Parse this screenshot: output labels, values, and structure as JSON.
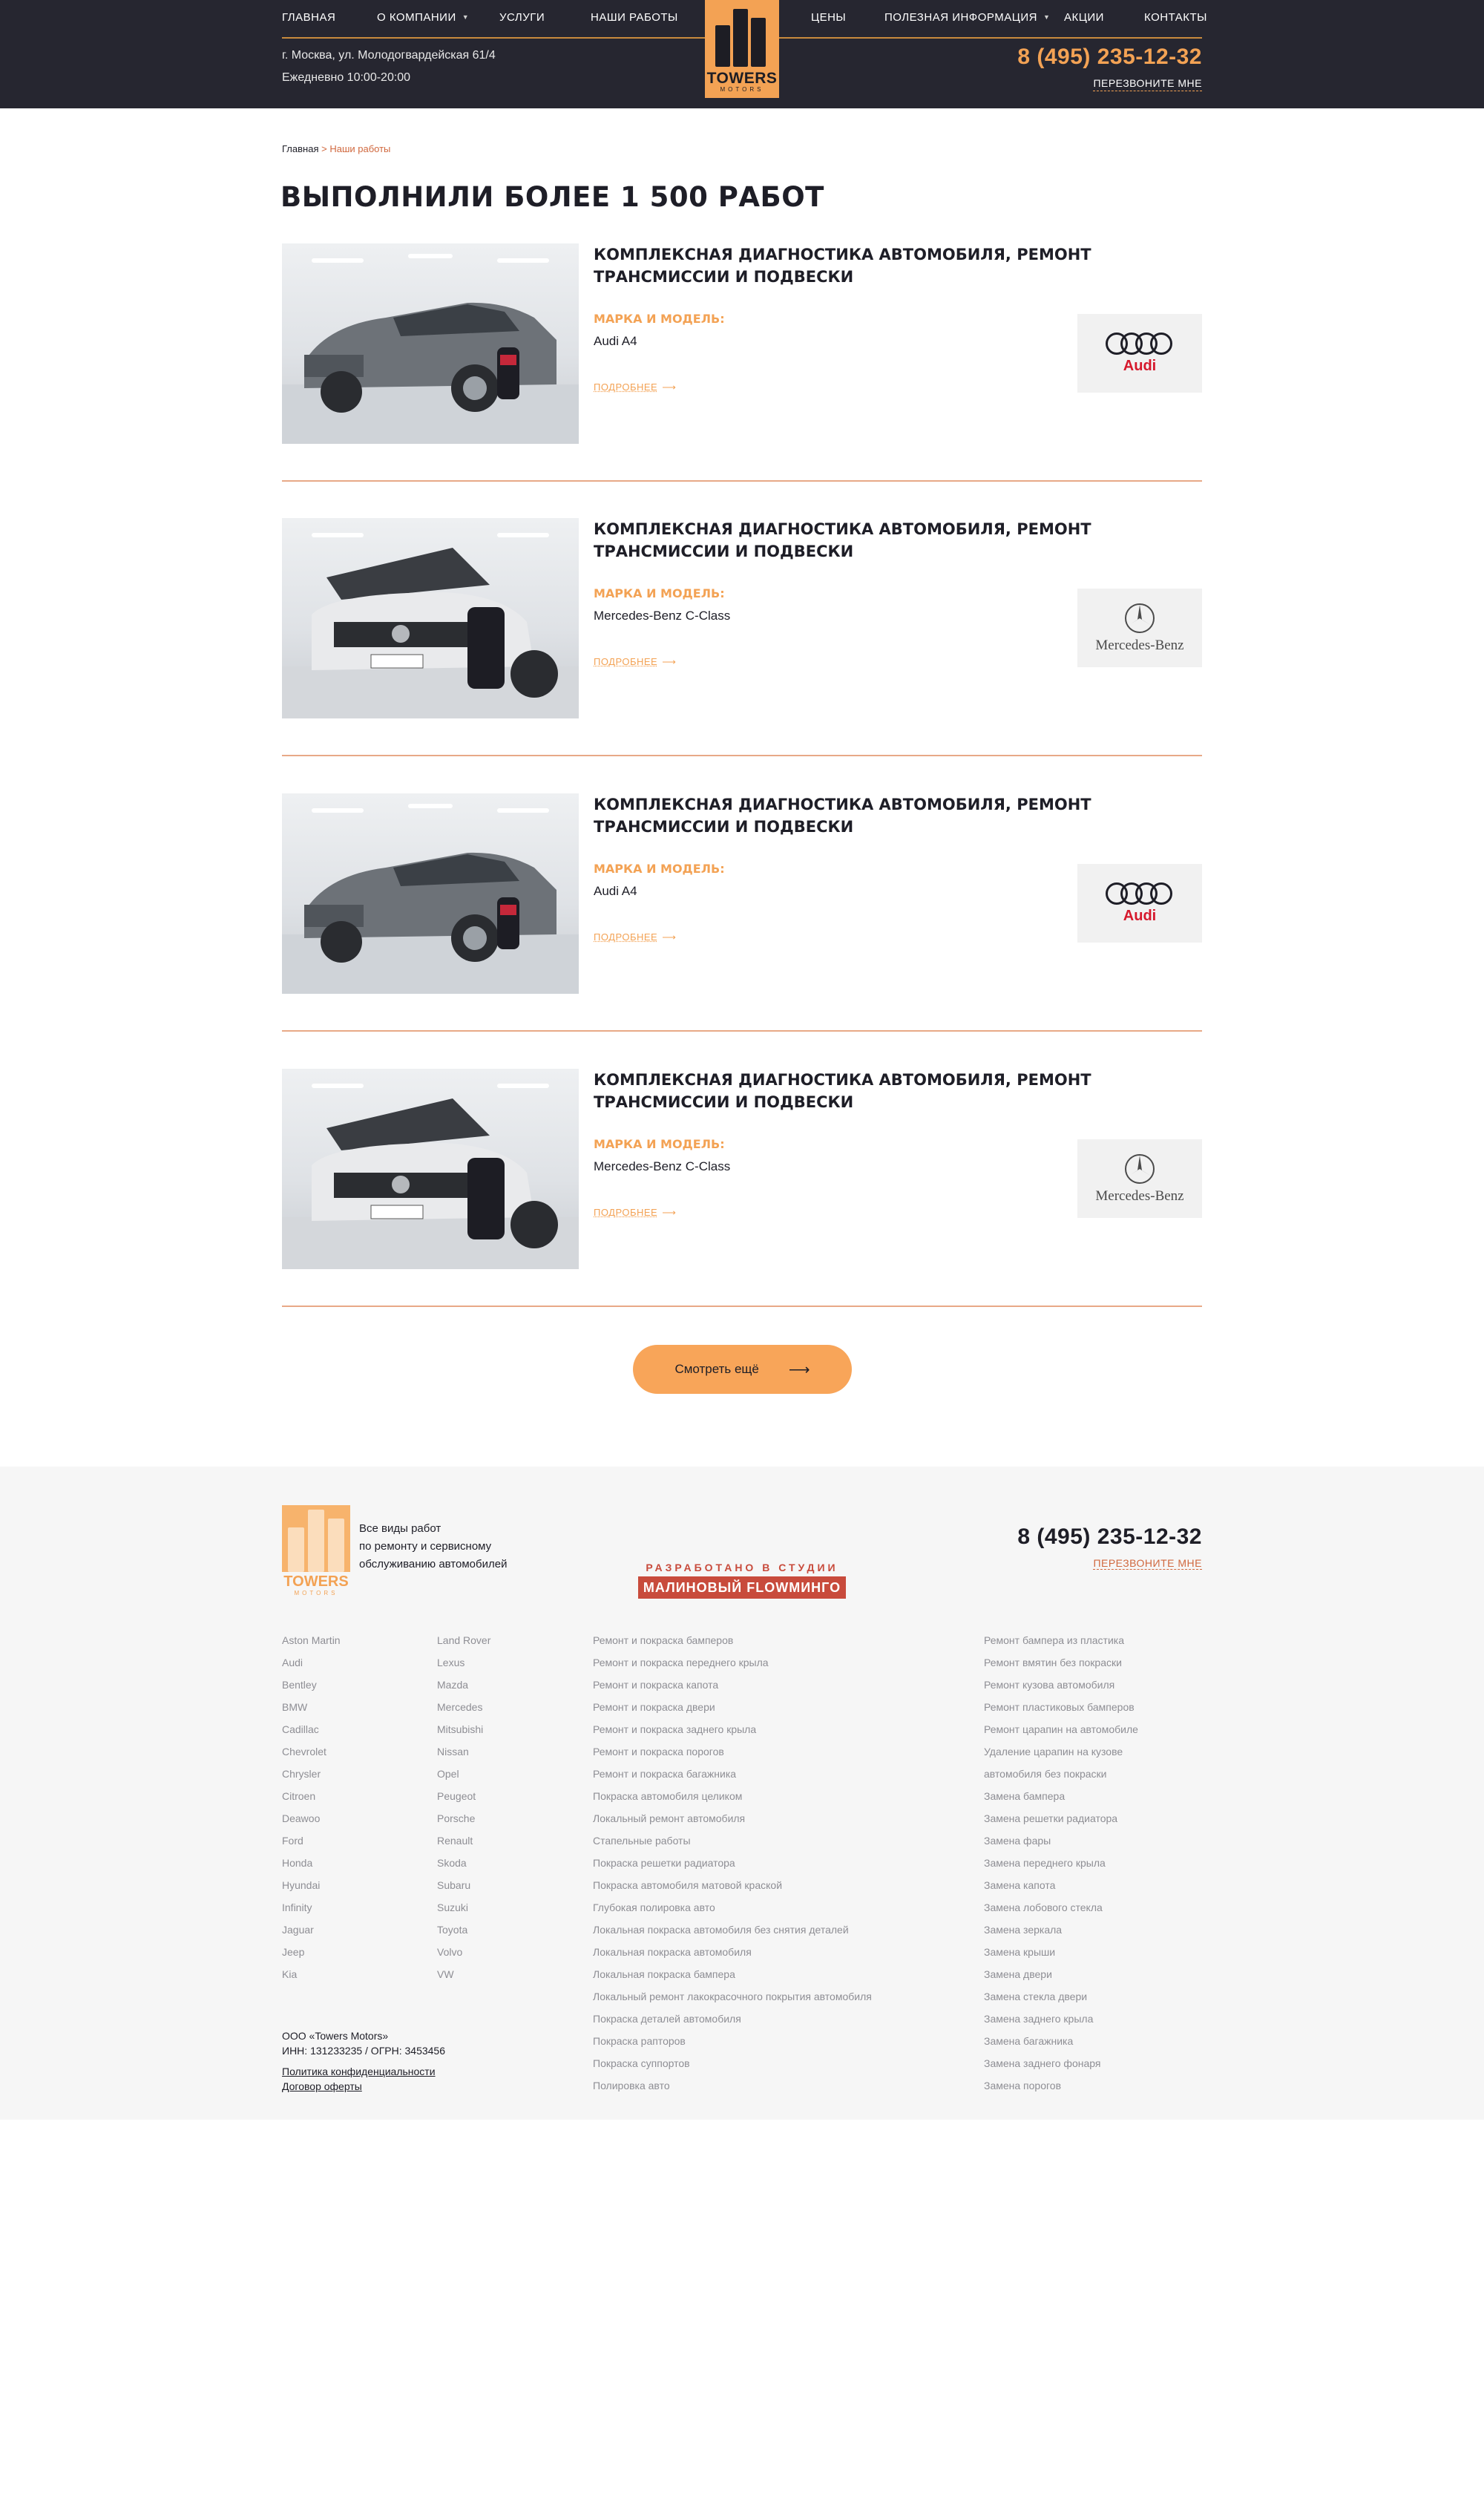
{
  "header": {
    "nav": [
      {
        "label": "ГЛАВНАЯ",
        "caret": false
      },
      {
        "label": "О КОМПАНИИ",
        "caret": true
      },
      {
        "label": "УСЛУГИ",
        "caret": false
      },
      {
        "label": "НАШИ РАБОТЫ",
        "caret": false
      },
      {
        "label": "ЦЕНЫ",
        "caret": false
      },
      {
        "label": "ПОЛЕЗНАЯ ИНФОРМАЦИЯ",
        "caret": true
      },
      {
        "label": "АКЦИИ",
        "caret": false
      },
      {
        "label": "КОНТАКТЫ",
        "caret": false
      }
    ],
    "address": "г. Москва, ул. Молодогвардейская 61/4",
    "hours": "Ежедневно 10:00-20:00",
    "logo_word": "TOWERS",
    "logo_sub": "MOTORS",
    "phone": "8 (495) 235-12-32",
    "callback": "ПЕРЕЗВОНИТЕ МНЕ"
  },
  "breadcrumb": {
    "home": "Главная",
    "sep": ">",
    "current": "Наши работы"
  },
  "page_title": "ВЫПОЛНИЛИ БОЛЕЕ 1 500 РАБОТ",
  "works": [
    {
      "title": "КОМПЛЕКСНАЯ ДИАГНОСТИКА АВТОМОБИЛЯ, РЕМОНТ ТРАНСМИССИИ И ПОДВЕСКИ",
      "brand_label": "МАРКА И МОДЕЛЬ:",
      "brand_value": "Audi A4",
      "more": "ПОДРОБНЕЕ",
      "logo": "audi",
      "logo_text": "Audi"
    },
    {
      "title": "КОМПЛЕКСНАЯ ДИАГНОСТИКА АВТОМОБИЛЯ, РЕМОНТ ТРАНСМИССИИ И ПОДВЕСКИ",
      "brand_label": "МАРКА И МОДЕЛЬ:",
      "brand_value": "Mercedes-Benz C-Class",
      "more": "ПОДРОБНЕЕ",
      "logo": "mercedes",
      "logo_text": "Mercedes-Benz"
    },
    {
      "title": "КОМПЛЕКСНАЯ ДИАГНОСТИКА АВТОМОБИЛЯ, РЕМОНТ ТРАНСМИССИИ И ПОДВЕСКИ",
      "brand_label": "МАРКА И МОДЕЛЬ:",
      "brand_value": "Audi A4",
      "more": "ПОДРОБНЕЕ",
      "logo": "audi",
      "logo_text": "Audi"
    },
    {
      "title": "КОМПЛЕКСНАЯ ДИАГНОСТИКА АВТОМОБИЛЯ, РЕМОНТ ТРАНСМИССИИ И ПОДВЕСКИ",
      "brand_label": "МАРКА И МОДЕЛЬ:",
      "brand_value": "Mercedes-Benz C-Class",
      "more": "ПОДРОБНЕЕ",
      "logo": "mercedes",
      "logo_text": "Mercedes-Benz"
    }
  ],
  "more_button": "Смотреть ещё",
  "footer": {
    "desc_lines": [
      "Все виды работ",
      "по ремонту и сервисному",
      "обслуживанию автомобилей"
    ],
    "logo_word": "TOWERS",
    "logo_sub": "MOTORS",
    "studio_caption": "РАЗРАБОТАНО В СТУДИИ",
    "studio_name": "МАЛИНОВЫЙ FLOWМИНГО",
    "phone": "8 (495) 235-12-32",
    "callback": "ПЕРЕЗВОНИТЕ МНЕ",
    "brands_col1": [
      "Aston Martin",
      "Audi",
      "Bentley",
      "BMW",
      "Cadillac",
      "Chevrolet",
      "Chrysler",
      "Citroen",
      "Deawoo",
      "Ford",
      "Honda",
      "Hyundai",
      "Infinity",
      "Jaguar",
      "Jeep",
      "Kia"
    ],
    "brands_col2": [
      "Land Rover",
      "Lexus",
      "Mazda",
      "Mercedes",
      "Mitsubishi",
      "Nissan",
      "Opel",
      "Peugeot",
      "Porsche",
      "Renault",
      "Skoda",
      "Subaru",
      "Suzuki",
      "Toyota",
      "Volvo",
      "VW"
    ],
    "services_col1": [
      "Ремонт и покраска бамперов",
      "Ремонт и покраска переднего крыла",
      "Ремонт и покраска капота",
      "Ремонт и покраска двери",
      "Ремонт и покраска заднего крыла",
      "Ремонт и покраска порогов",
      "Ремонт и покраска багажника",
      "Покраска автомобиля целиком",
      "Локальный ремонт автомобиля",
      "Стапельные работы",
      "Покраска решетки радиатора",
      "Покраска автомобиля матовой краской",
      "Глубокая полировка авто",
      "Локальная покраска автомобиля без снятия деталей",
      "Локальная покраска автомобиля",
      "Локальная покраска бампера",
      "Локальный ремонт лакокрасочного покрытия автомобиля",
      "Покраска деталей автомобиля",
      "Покраска рапторов",
      "Покраска суппортов",
      "Полировка авто"
    ],
    "services_col2": [
      "Ремонт бампера из пластика",
      "Ремонт вмятин без покраски",
      "Ремонт кузова автомобиля",
      "Ремонт пластиковых бамперов",
      "Ремонт царапин на автомобиле",
      "Удаление царапин на кузове",
      "автомобиля без покраски",
      "Замена бампера",
      "Замена решетки радиатора",
      "Замена фары",
      "Замена переднего крыла",
      "Замена капота",
      "Замена лобового стекла",
      "Замена зеркала",
      "Замена крыши",
      "Замена двери",
      "Замена стекла двери",
      "Замена заднего крыла",
      "Замена багажника",
      "Замена заднего фонаря",
      "Замена порогов"
    ],
    "company": "ООО «Towers Motors»",
    "requisites": "ИНН: 131233235 / ОГРН: 3453456",
    "privacy": "Политика конфиденциальности",
    "offer": "Договор оферты"
  },
  "colors": {
    "accent": "#f3a254",
    "dark": "#262630",
    "link": "#d0683e"
  }
}
